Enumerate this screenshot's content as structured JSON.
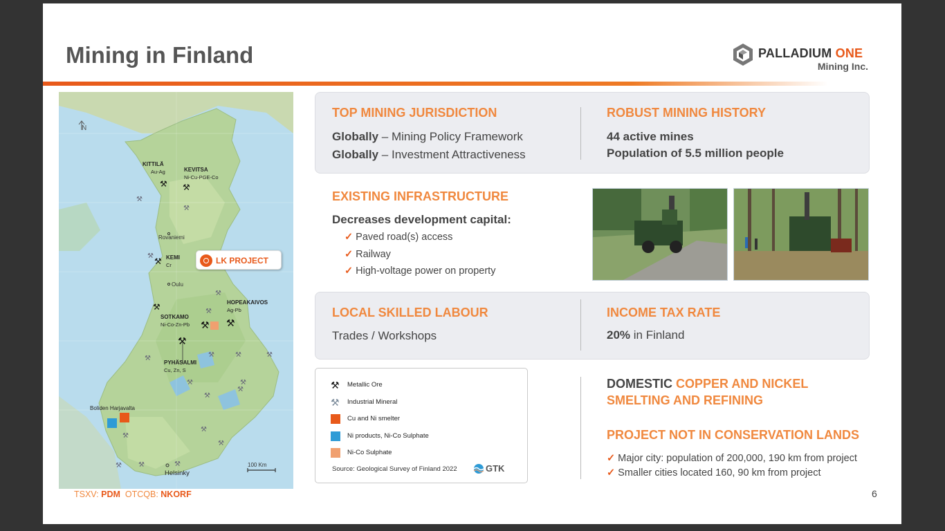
{
  "slide": {
    "title": "Mining in Finland",
    "page_number": "6"
  },
  "logo": {
    "name_part1": "PALLADIUM ",
    "name_part2": "ONE",
    "subtitle": "Mining Inc."
  },
  "map": {
    "north_label": "N",
    "labels": [
      {
        "name": "KITTILÄ",
        "sub": "Au-Ag"
      },
      {
        "name": "KEVITSA",
        "sub": "Ni-Cu-PGE-Co"
      },
      {
        "name": "KEMI",
        "sub": "Cr"
      },
      {
        "name": "HOPEAKAIVOS",
        "sub": "Ag-Pb"
      },
      {
        "name": "SOTKAMO",
        "sub": "Ni-Co-Zn-Pb"
      },
      {
        "name": "PYHÄSALMI",
        "sub": "Cu, Zn, S"
      }
    ],
    "cities": [
      "Rovaniemi",
      "Oulu",
      "Helsinky",
      "Boliden Harjavalta"
    ],
    "scale_label": "100 Km",
    "lk_project": "LK PROJECT"
  },
  "top_jurisdiction": {
    "heading": "TOP MINING JURISDICTION",
    "line1_bold": "Globally",
    "line1_rest": " – Mining Policy Framework",
    "line2_bold": "Globally",
    "line2_rest": " – Investment Attractiveness"
  },
  "mining_history": {
    "heading": "ROBUST MINING HISTORY",
    "line1": "44 active mines",
    "line2": "Population of 5.5 million people"
  },
  "infrastructure": {
    "heading": "EXISTING INFRASTRUCTURE",
    "subheading": "Decreases development capital:",
    "items": [
      "Paved road(s) access",
      "Railway",
      "High-voltage power on property"
    ]
  },
  "labour": {
    "heading": "LOCAL SKILLED LABOUR",
    "text": "Trades / Workshops"
  },
  "tax": {
    "heading": "INCOME TAX RATE",
    "bold": "20%",
    "rest": " in Finland"
  },
  "legend": {
    "items": [
      "Metallic Ore",
      "Industrial Mineral",
      "Cu and Ni smelter",
      "Ni products, Ni-Co Sulphate",
      "Ni-Co Sulphate"
    ],
    "source": "Source: Geological Survey of Finland 2022",
    "gtk": "GTK"
  },
  "smelting": {
    "prefix": "DOMESTIC ",
    "highlight_line1": "COPPER AND NICKEL",
    "line2": "SMELTING AND REFINING"
  },
  "conservation": {
    "heading": "PROJECT NOT IN CONSERVATION LANDS",
    "items": [
      "Major city: population of 200,000, 190 km from project",
      "Smaller cities located 160, 90 km from project"
    ]
  },
  "footer": {
    "label1": "TSXV: ",
    "ticker1": "PDM",
    "label2": "  OTCQB: ",
    "ticker2": "NKORF"
  },
  "colors": {
    "accent_orange": "#e8591a",
    "heading_orange": "#f0883e",
    "panel_gray": "#ecedf1",
    "map_land": "#b5d39a",
    "map_water": "#b9dced"
  }
}
